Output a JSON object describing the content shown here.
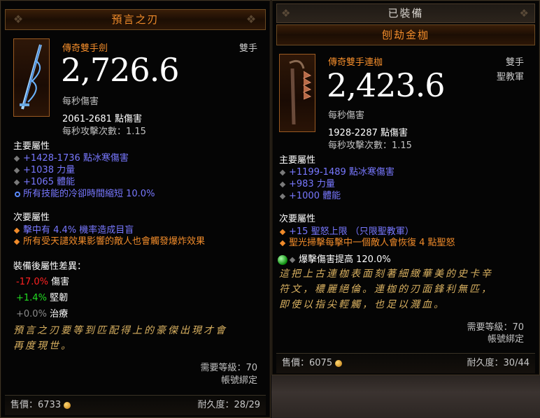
{
  "left": {
    "title": "預言之刃",
    "type": "傳奇雙手劍",
    "hand": "雙手",
    "dps": "2,726.6",
    "dps_label": "每秒傷害",
    "damage_range": "2061-2681 點傷害",
    "attack_speed": "每秒攻擊次數：1.15",
    "primary_header": "主要屬性",
    "primary": [
      "+1428-1736 點冰寒傷害",
      "+1038 力量",
      "+1065 體能",
      "所有技能的冷卻時間縮短 10.0%"
    ],
    "secondary_header": "次要屬性",
    "secondary": [
      "擊中有 4.4% 機率造成目盲",
      "所有受天譴效果影響的敵人也會觸發爆炸效果"
    ],
    "diff_header": "裝備後屬性差異：",
    "diff": [
      {
        "value": "-17.0%",
        "label": "傷害"
      },
      {
        "value": "+1.4%",
        "label": "堅韌"
      },
      {
        "value": "+0.0%",
        "label": "治療"
      }
    ],
    "lore_1": "預言之刃要等到匹配得上的豪傑出現才會",
    "lore_2": "再度現世。",
    "req_level": "需要等級：70",
    "account_bound": "帳號綁定",
    "sell": "售價：6733",
    "durability": "耐久度：28/29"
  },
  "right": {
    "equipped": "已裝備",
    "title": "刨劫金枷",
    "type": "傳奇雙手連枷",
    "hand": "雙手",
    "class": "聖教軍",
    "dps": "2,423.6",
    "dps_label": "每秒傷害",
    "damage_range": "1928-2287 點傷害",
    "attack_speed": "每秒攻擊次數：1.15",
    "primary_header": "主要屬性",
    "primary": [
      "+1199-1489 點冰寒傷害",
      "+983 力量",
      "+1000 體能"
    ],
    "secondary_header": "次要屬性",
    "secondary": [
      "+15 聖怒上限 （只限聖教軍）",
      "聖光掃擊每擊中一個敵人會恢復 4 點聖怒"
    ],
    "socket": "爆擊傷害提高 120.0%",
    "lore_1": "這把上古連枷表面刻著細緻華美的史卡辛",
    "lore_2": "符文，穠麗絕倫。連枷的刃面鋒利無匹，",
    "lore_3": "即使以指尖輕觸，也足以濺血。",
    "req_level": "需要等級：70",
    "account_bound": "帳號綁定",
    "sell": "售價：6075",
    "durability": "耐久度：30/44"
  },
  "colors": {
    "legendary": "#f08b2a",
    "magic": "#7878ff",
    "lore": "#d8b060"
  }
}
